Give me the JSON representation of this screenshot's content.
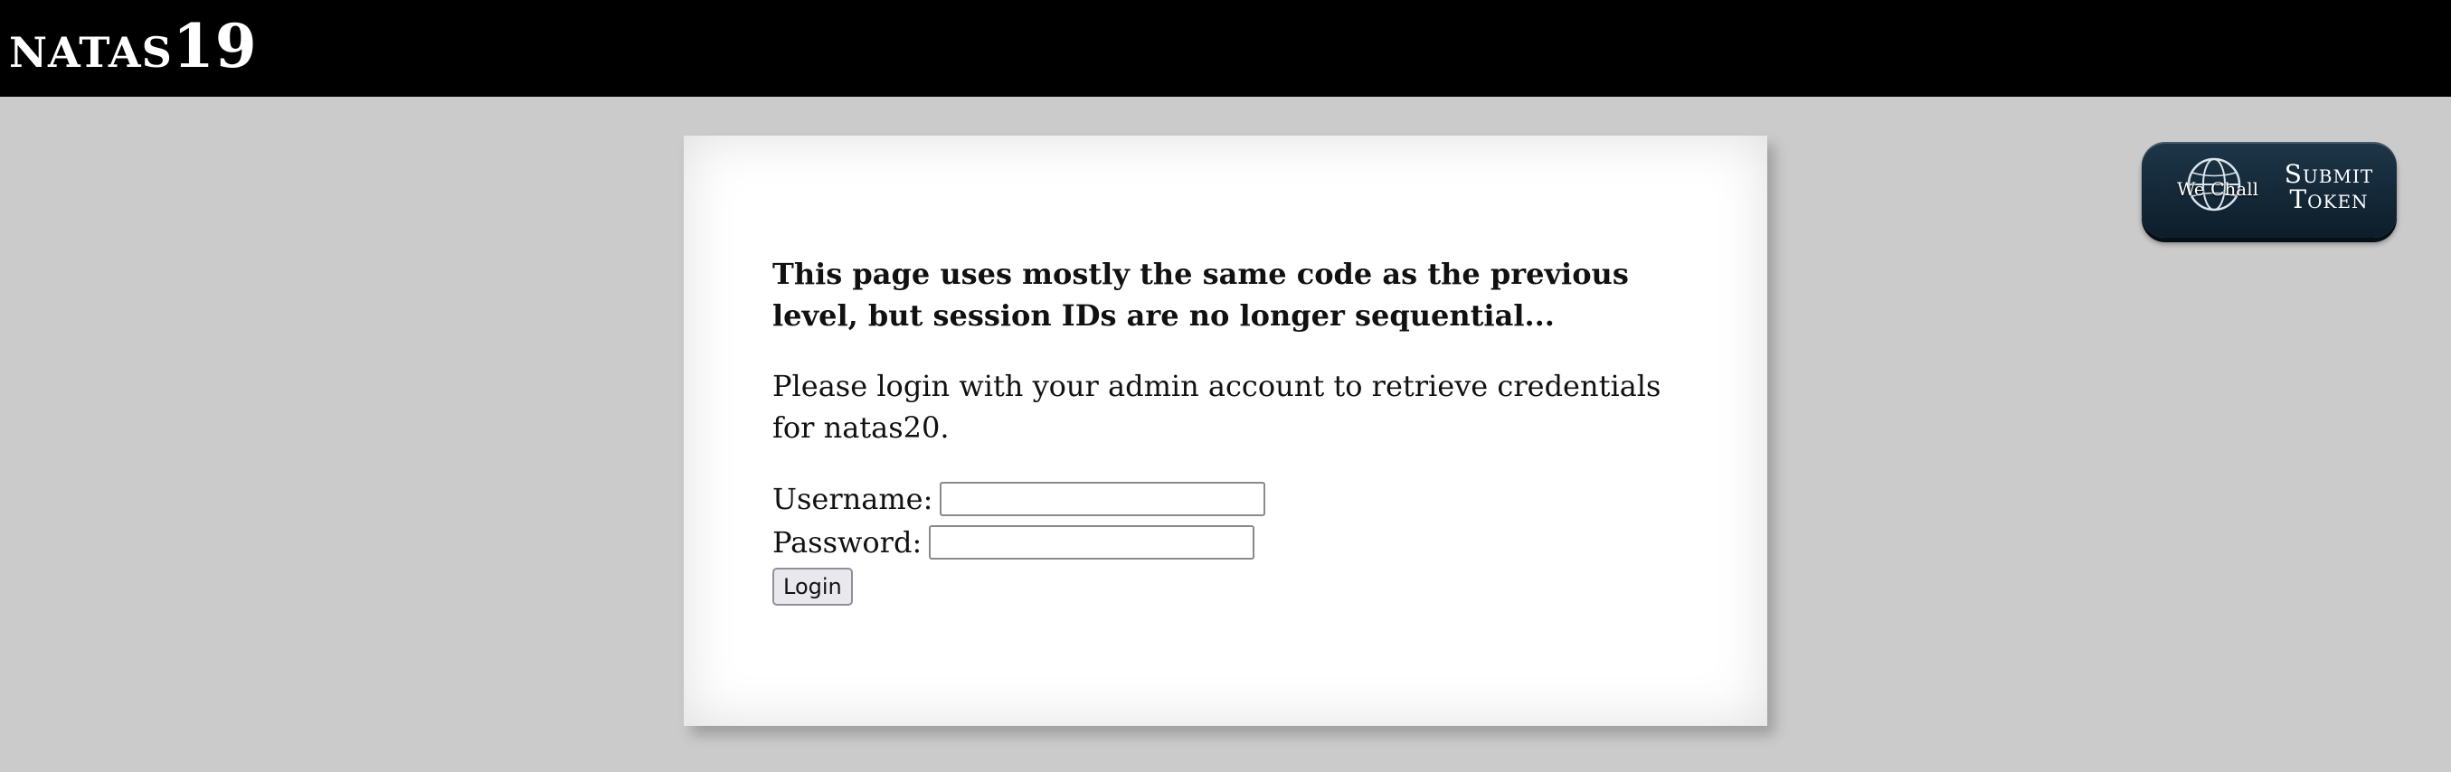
{
  "header": {
    "title_main": "NATAS",
    "title_number": "19"
  },
  "main": {
    "intro": "This page uses mostly the same code as the previous level, but session IDs are no longer sequential...",
    "description": "Please login with your admin account to retrieve credentials for natas20.",
    "form": {
      "username_label": "Username:",
      "username_value": "",
      "password_label": "Password:",
      "password_value": "",
      "login_label": "Login"
    }
  },
  "wechall": {
    "logo_text": "We Chall",
    "button_line1": "Submit",
    "button_line2": "Token",
    "icon": "globe-icon"
  }
}
